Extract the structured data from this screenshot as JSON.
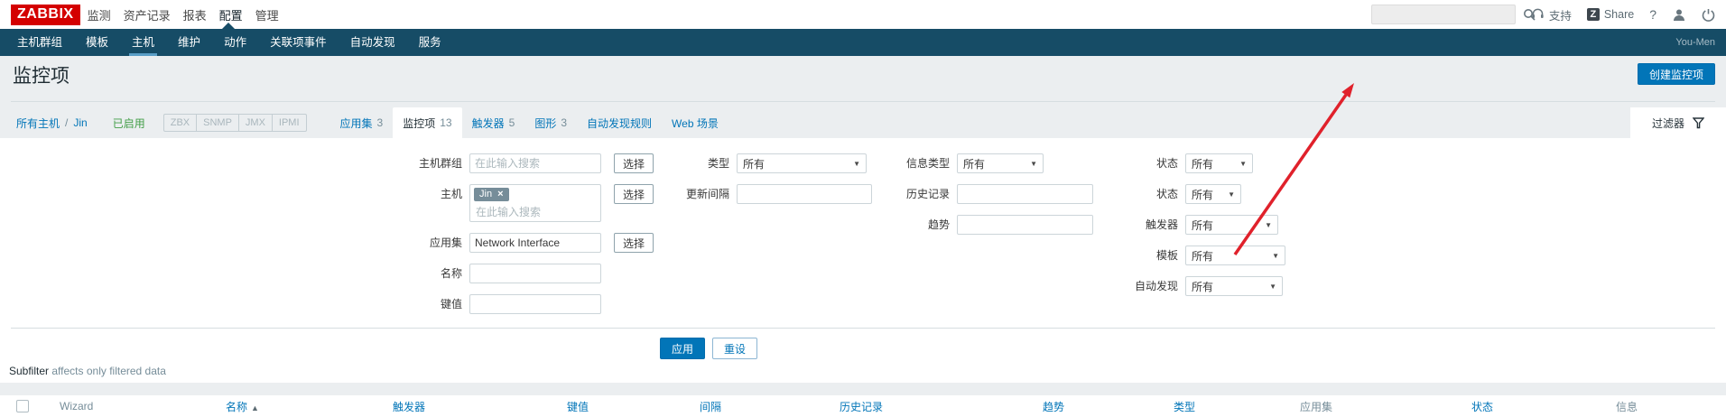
{
  "colors": {
    "accent": "#0275b8",
    "navbar": "#164c66",
    "logo_red": "#d40000",
    "enabled_green": "#429e47",
    "arrow_red": "#e0212b"
  },
  "topbar": {
    "logo": "ZABBIX",
    "menu": [
      "监测",
      "资产记录",
      "报表",
      "配置",
      "管理"
    ],
    "search_placeholder": "",
    "support": "支持",
    "share_badge": "Z",
    "share": "Share",
    "help": "?"
  },
  "navbar": {
    "items": [
      "主机群组",
      "模板",
      "主机",
      "维护",
      "动作",
      "关联项事件",
      "自动发现",
      "服务"
    ],
    "user": "You-Men"
  },
  "header": {
    "title": "监控项",
    "create_button": "创建监控项"
  },
  "breadcrumb": {
    "all_hosts": "所有主机",
    "separator": "/",
    "host": "Jin",
    "enabled": "已启用",
    "interfaces": [
      "ZBX",
      "SNMP",
      "JMX",
      "IPMI"
    ]
  },
  "tabs": {
    "applications": "应用集",
    "applications_count": "3",
    "items": "监控项",
    "items_count": "13",
    "triggers": "触发器",
    "triggers_count": "5",
    "graphs": "图形",
    "graphs_count": "3",
    "discovery_rules": "自动发现规则",
    "web": "Web 场景",
    "filter": "过滤器"
  },
  "filter": {
    "select_button": "选择",
    "search_placeholder": "在此输入搜索",
    "col1": {
      "hostgroup_label": "主机群组",
      "host_label": "主机",
      "host_chip": "Jin",
      "host_chip_close": "×",
      "app_label": "应用集",
      "app_value": "Network Interface",
      "name_label": "名称",
      "key_label": "键值"
    },
    "col2": {
      "type_label": "类型",
      "type_value": "所有",
      "interval_label": "更新间隔"
    },
    "col3": {
      "infotype_label": "信息类型",
      "infotype_value": "所有",
      "history_label": "历史记录",
      "trends_label": "趋势"
    },
    "col4": {
      "state_label": "状态",
      "state_value": "所有",
      "status_label": "状态",
      "status_value": "所有",
      "triggers_label": "触发器",
      "triggers_value": "所有",
      "template_label": "模板",
      "template_value": "所有",
      "discovery_label": "自动发现",
      "discovery_value": "所有"
    },
    "apply_label": "应用",
    "reset_label": "重设"
  },
  "subfilter": {
    "title": "Subfilter",
    "note": "affects only filtered data"
  },
  "table": {
    "headers": [
      {
        "label": "Wizard",
        "sortable": false
      },
      {
        "label": "名称",
        "sortable": true,
        "sorted": "asc",
        "sort_glyph": "▲"
      },
      {
        "label": "触发器",
        "sortable": true
      },
      {
        "label": "键值",
        "sortable": true
      },
      {
        "label": "间隔",
        "sortable": true
      },
      {
        "label": "历史记录",
        "sortable": true
      },
      {
        "label": "趋势",
        "sortable": true
      },
      {
        "label": "类型",
        "sortable": true
      },
      {
        "label": "应用集",
        "sortable": false
      },
      {
        "label": "状态",
        "sortable": true
      },
      {
        "label": "信息",
        "sortable": false
      }
    ]
  }
}
